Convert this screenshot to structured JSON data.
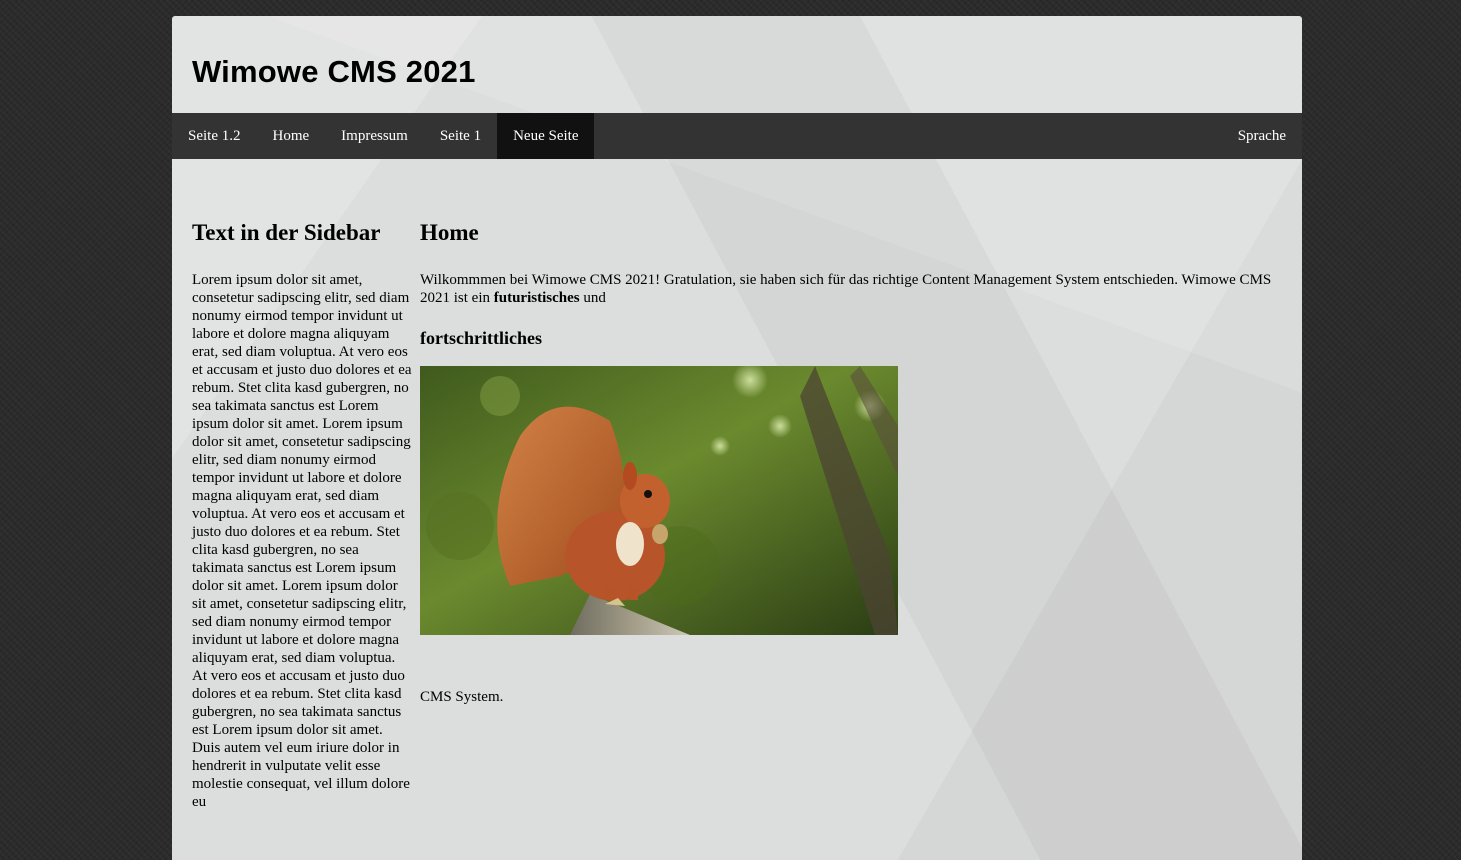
{
  "header": {
    "title": "Wimowe CMS 2021"
  },
  "nav": {
    "items": [
      {
        "label": "Seite 1.2",
        "active": false
      },
      {
        "label": "Home",
        "active": false
      },
      {
        "label": "Impressum",
        "active": false
      },
      {
        "label": "Seite 1",
        "active": false
      },
      {
        "label": "Neue Seite",
        "active": true
      }
    ],
    "language_label": "Sprache"
  },
  "sidebar": {
    "heading": "Text in der Sidebar",
    "text": "Lorem ipsum dolor sit amet, consetetur sadipscing elitr, sed diam nonumy eirmod tempor invidunt ut labore et dolore magna aliquyam erat, sed diam voluptua. At vero eos et accusam et justo duo dolores et ea rebum. Stet clita kasd gubergren, no sea takimata sanctus est Lorem ipsum dolor sit amet. Lorem ipsum dolor sit amet, consetetur sadipscing elitr, sed diam nonumy eirmod tempor invidunt ut labore et dolore magna aliquyam erat, sed diam voluptua. At vero eos et accusam et justo duo dolores et ea rebum. Stet clita kasd gubergren, no sea takimata sanctus est Lorem ipsum dolor sit amet. Lorem ipsum dolor sit amet, consetetur sadipscing elitr, sed diam nonumy eirmod tempor invidunt ut labore et dolore magna aliquyam erat, sed diam voluptua. At vero eos et accusam et justo duo dolores et ea rebum. Stet clita kasd gubergren, no sea takimata sanctus est Lorem ipsum dolor sit amet. Duis autem vel eum iriure dolor in hendrerit in vulputate velit esse molestie consequat, vel illum dolore eu"
  },
  "main": {
    "heading": "Home",
    "intro_text": "Wilkommmen bei Wimowe CMS 2021! Gratulation, sie haben sich für das richtige Content Management System entschieden. Wimowe CMS 2021 ist ein ",
    "intro_bold": "futuristisches",
    "intro_end": " und",
    "subheading": "fortschrittliches",
    "closing_text": "CMS System."
  },
  "colors": {
    "background": "#2b2b2b",
    "panel": "#dcdddd",
    "navbar": "#333333",
    "nav_active": "#111111"
  },
  "icons": {
    "photo": "squirrel-photo"
  }
}
